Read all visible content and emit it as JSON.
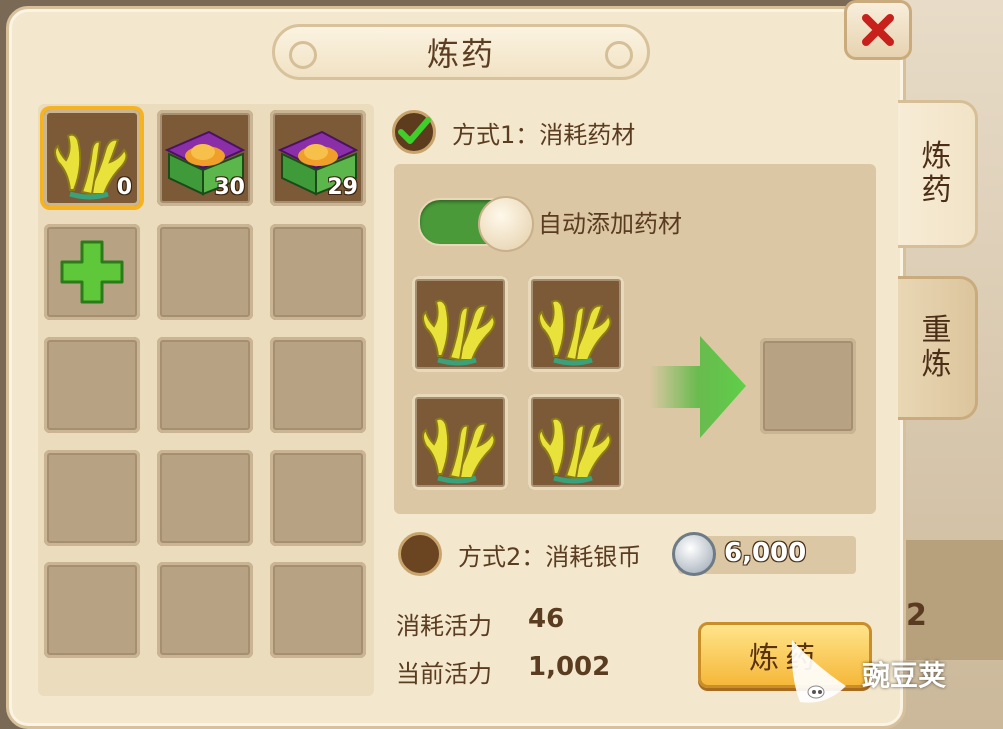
{
  "window": {
    "title": "炼药"
  },
  "tabs": [
    {
      "label": "炼\n药",
      "active": true
    },
    {
      "label": "重\n炼",
      "active": false
    }
  ],
  "inventory": {
    "items": [
      {
        "icon": "coral-icon",
        "count": "0",
        "selected": true
      },
      {
        "icon": "treasure-chest-icon",
        "count": "30"
      },
      {
        "icon": "treasure-chest-icon",
        "count": "29"
      },
      {
        "icon": "add-icon"
      }
    ]
  },
  "method1": {
    "label": "方式1：消耗药材",
    "checked": true
  },
  "auto_add": {
    "label": "自动添加药材",
    "on": true
  },
  "ingredients": [
    {
      "icon": "coral-icon"
    },
    {
      "icon": "coral-icon"
    },
    {
      "icon": "coral-icon"
    },
    {
      "icon": "coral-icon"
    }
  ],
  "method2": {
    "label": "方式2：消耗银币",
    "checked": false,
    "coin_icon": "silver-coin-icon",
    "cost": "6,000"
  },
  "stats": {
    "consume_label": "消耗活力",
    "consume_value": "46",
    "current_label": "当前活力",
    "current_value": "1,002"
  },
  "refine_button": {
    "label": "炼药"
  },
  "background": {
    "partial_number": "2"
  },
  "watermark": {
    "text": "豌豆荚"
  },
  "colors": {
    "accent_green": "#4b9a3a",
    "button_gold": "#f5b83a",
    "close_red": "#c8201a"
  }
}
